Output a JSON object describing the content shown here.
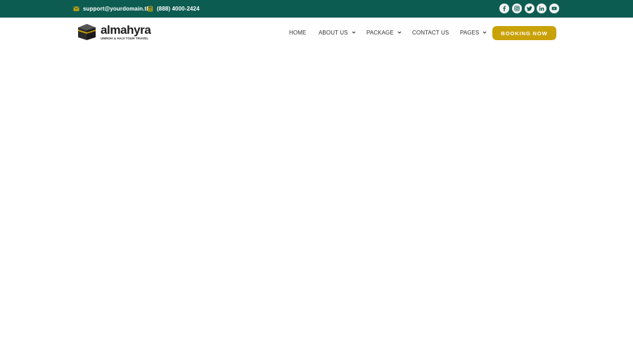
{
  "topbar": {
    "email": {
      "icon": "mail-icon",
      "text": "support@yourdomain.tld"
    },
    "phone": {
      "icon": "phone-icon",
      "text": "(888) 4000-2424"
    },
    "socials": [
      {
        "name": "facebook-icon"
      },
      {
        "name": "instagram-icon"
      },
      {
        "name": "twitter-icon"
      },
      {
        "name": "linkedin-icon"
      },
      {
        "name": "youtube-icon"
      }
    ]
  },
  "logo": {
    "name": "almahyra",
    "tagline": "UMROH & HAJI TOUR TRAVEL"
  },
  "nav": {
    "items": [
      {
        "label": "HOME"
      },
      {
        "label": "ABOUT US"
      },
      {
        "label": "PACKAGE"
      },
      {
        "label": "CONTACT US"
      },
      {
        "label": "PAGES"
      }
    ],
    "cta": "BOOKING NOW"
  },
  "colors": {
    "topbar_bg": "#0d5c52",
    "accent": "#c9a20a",
    "text_dark": "#333333"
  }
}
